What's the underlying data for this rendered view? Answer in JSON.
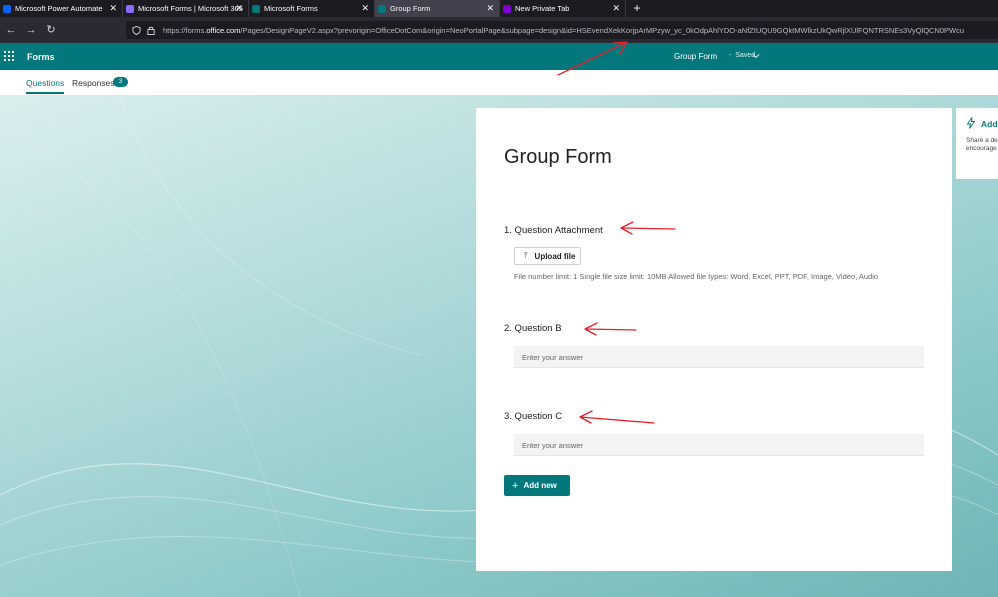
{
  "browser": {
    "tabs": [
      {
        "label": "Microsoft Power Automate",
        "active": false,
        "favicon_color": "#0066ff"
      },
      {
        "label": "Microsoft Forms | Microsoft 365",
        "active": false,
        "favicon_color": "#8a6cff"
      },
      {
        "label": "Microsoft Forms",
        "active": false,
        "favicon_color": "#03787c"
      },
      {
        "label": "Group Form",
        "active": true,
        "favicon_color": "#03787c"
      },
      {
        "label": "New Private Tab",
        "active": false,
        "favicon_color": "#8000d7"
      }
    ],
    "close_glyph": "✕",
    "new_tab_glyph": "+",
    "url_prefix": "https://forms.",
    "url_domain": "office.com",
    "url_rest": "/Pages/DesignPageV2.aspx?prevorigin=OfficeDotCom&origin=NeoPortalPage&subpage=design&id=HSEvendXekKorjpArMPzyw_yc_0kOdpAhlYDO-aNfZtUQU9GQktMWlkzUkQwRjlXUlFQNTRSNEs3VyQlQCN0PWcu"
  },
  "app": {
    "name": "Forms",
    "form_title": "Group Form",
    "save_status": "Saved",
    "accent_color": "#03787c"
  },
  "subnav": {
    "questions_label": "Questions",
    "responses_label": "Responses",
    "responses_count": "3"
  },
  "form": {
    "heading": "Group Form",
    "questions": [
      {
        "label": "1. Question Attachment"
      },
      {
        "label": "2. Question B",
        "placeholder": "Enter your answer"
      },
      {
        "label": "3. Question C",
        "placeholder": "Enter your answer"
      }
    ],
    "upload_label": "Upload file",
    "file_note": "File number limit: 1   Single file size limit: 10MB   Allowed file types: Word, Excel, PPT, PDF, Image, Video, Audio",
    "add_new_label": "Add new"
  },
  "side_panel": {
    "title": "Add",
    "desc_line1": "Share a des",
    "desc_line2": "encourage"
  },
  "annotation_color": "#e8202a"
}
